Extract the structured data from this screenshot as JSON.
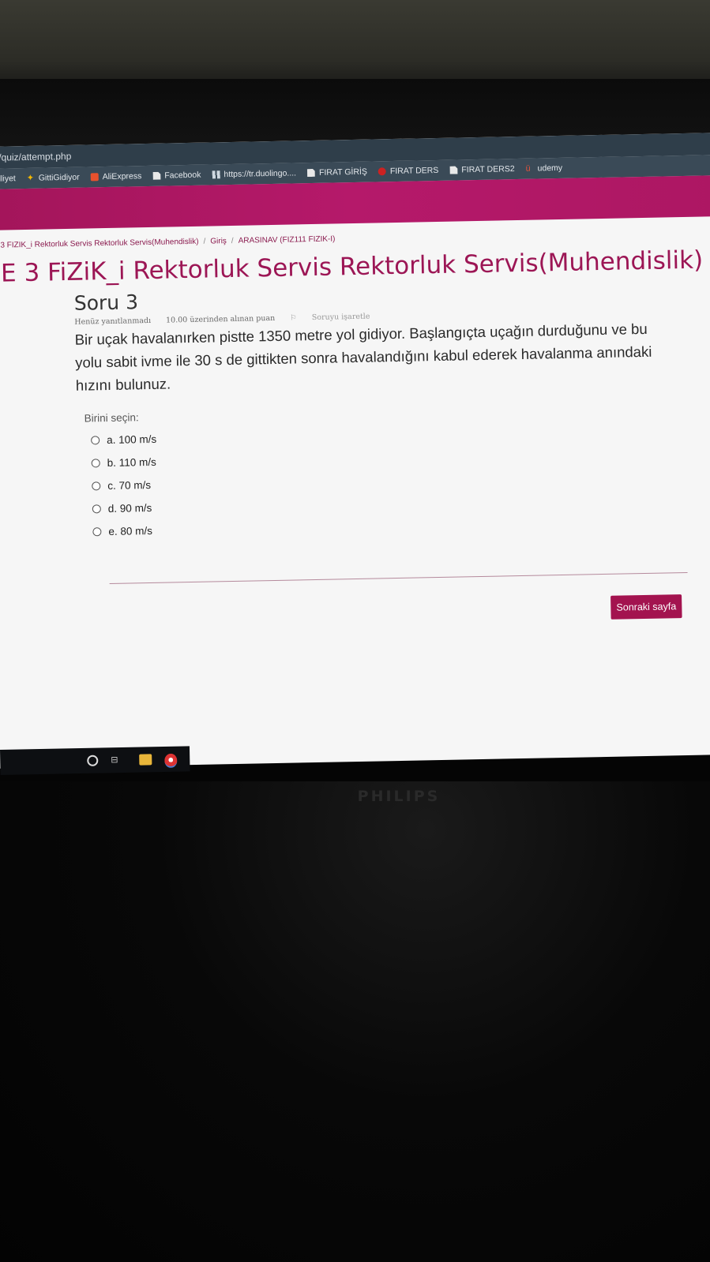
{
  "browser": {
    "url": "/quiz/attempt.php",
    "bookmarks": [
      {
        "label": "lliyet",
        "icon": ""
      },
      {
        "label": "GittiGidiyor",
        "icon": "gittigidiyor-icon"
      },
      {
        "label": "AliExpress",
        "icon": "aliexpress-icon"
      },
      {
        "label": "Facebook",
        "icon": "document-icon"
      },
      {
        "label": "https://tr.duolingo....",
        "icon": "grid-icon"
      },
      {
        "label": "FIRAT GİRİŞ",
        "icon": "document-icon"
      },
      {
        "label": "FIRAT DERS",
        "icon": "firat-icon"
      },
      {
        "label": "FIRAT DERS2",
        "icon": "document-icon"
      },
      {
        "label": "udemy",
        "icon": "udemy-icon"
      }
    ]
  },
  "breadcrumb": {
    "course": "3 FIZIK_i Rektorluk Servis Rektorluk Servis(Muhendislik)",
    "home": "Giriş",
    "quiz": "ARASINAV (FIZ111 FIZIK-I)"
  },
  "page": {
    "title": "E 3 FiZiK_i Rektorluk Servis Rektorluk Servis(Muhendislik)"
  },
  "question": {
    "number_label": "Soru 3",
    "status": "Henüz yanıtlanmadı",
    "points": "10.00 üzerinden alınan puan",
    "flag_label": "Soruyu işaretle",
    "text": "Bir uçak havalanırken pistte 1350 metre yol gidiyor. Başlangıçta uçağın durduğunu ve bu yolu sabit ivme ile 30 s de gittikten sonra havalandığını kabul ederek havalanma anındaki hızını bulunuz.",
    "prompt": "Birini seçin:",
    "options": [
      "a. 100 m/s",
      "b. 110 m/s",
      "c. 70 m/s",
      "d. 90 m/s",
      "e. 80 m/s"
    ]
  },
  "navigation": {
    "next_label": "Sonraki sayfa"
  },
  "monitor": {
    "brand": "PHILIPS"
  }
}
